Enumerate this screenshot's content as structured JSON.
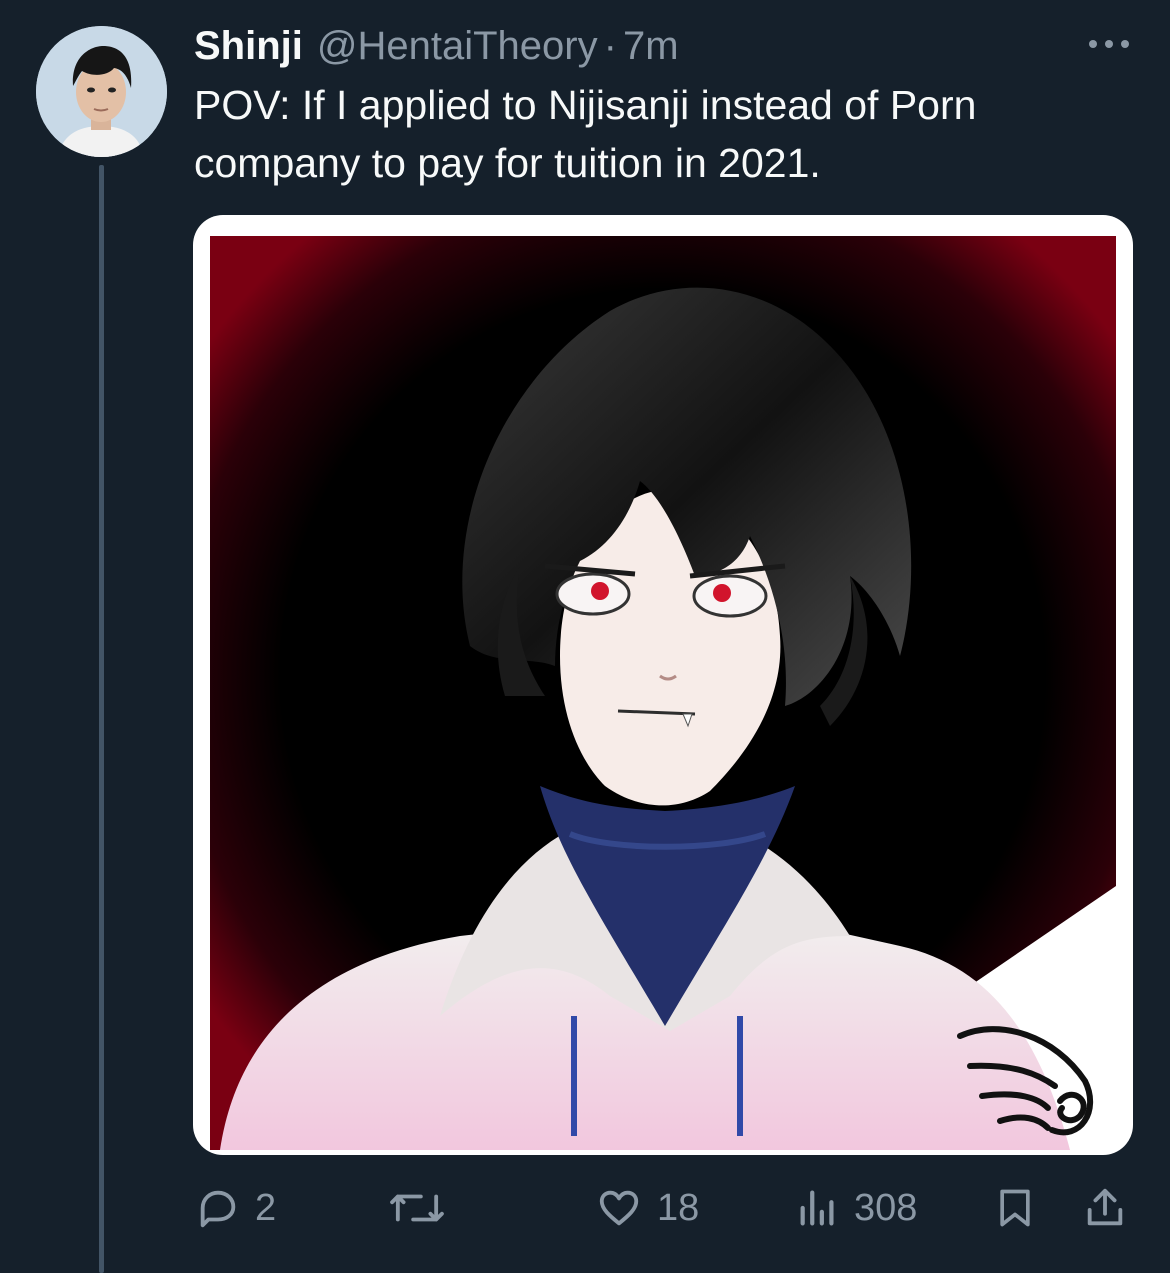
{
  "tweet": {
    "author_name": "Shinji",
    "handle": "@HentaiTheory",
    "separator": "·",
    "time": "7m",
    "text": "POV: If I applied to Nijisanji instead of Porn\ncompany to pay for tuition in 2021.",
    "more_icon": "more-horizontal-icon",
    "avatar_icon": "avatar"
  },
  "actions": {
    "reply": {
      "icon": "reply-icon",
      "count": "2"
    },
    "retweet": {
      "icon": "retweet-icon",
      "count": ""
    },
    "like": {
      "icon": "heart-icon",
      "count": "18"
    },
    "views": {
      "icon": "views-icon",
      "count": "308"
    },
    "bookmark": {
      "icon": "bookmark-icon"
    },
    "share": {
      "icon": "share-icon"
    }
  },
  "colors": {
    "background": "#15202b",
    "primary_text": "#f7f9f9",
    "secondary_text": "#8b98a5",
    "thread_line": "#425466",
    "media_frame": "#ffffff",
    "art_red": "#7a0012"
  }
}
